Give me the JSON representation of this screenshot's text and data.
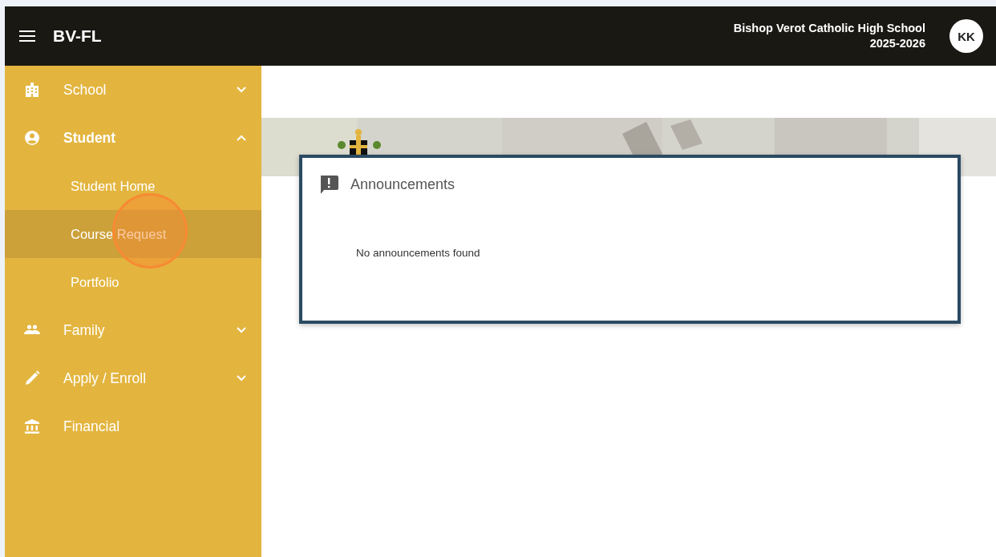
{
  "app_bar": {
    "title": "BV-FL",
    "school": "Bishop Verot Catholic High School",
    "year": "2025-2026",
    "avatar": "KK"
  },
  "sidebar": {
    "items": [
      {
        "label": "School",
        "kind": "group",
        "expanded": false
      },
      {
        "label": "Student",
        "kind": "group",
        "expanded": true,
        "children": [
          {
            "label": "Student Home",
            "selected": false
          },
          {
            "label": "Course Request",
            "selected": true
          },
          {
            "label": "Portfolio",
            "selected": false
          }
        ]
      },
      {
        "label": "Family",
        "kind": "group",
        "expanded": false
      },
      {
        "label": "Apply / Enroll",
        "kind": "group",
        "expanded": false
      },
      {
        "label": "Financial",
        "kind": "link"
      }
    ]
  },
  "announcements": {
    "title": "Announcements",
    "message": "No announcements found"
  }
}
